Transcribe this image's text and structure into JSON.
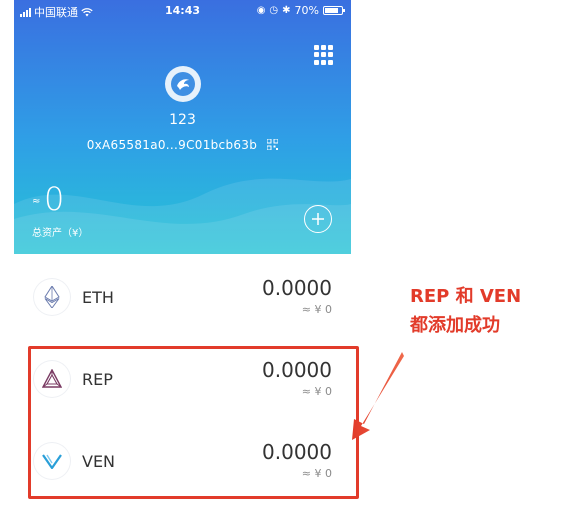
{
  "status_bar": {
    "carrier": "中国联通",
    "time": "14:43",
    "battery": "70%"
  },
  "wallet": {
    "name": "123",
    "address": "0xA65581a0...9C01bcb63b",
    "approx_symbol": "≈",
    "total_value": "0",
    "total_label": "总资产（¥）"
  },
  "tokens": [
    {
      "symbol": "ETH",
      "balance": "0.0000",
      "fiat": "≈ ¥ 0",
      "icon": "eth-icon"
    },
    {
      "symbol": "REP",
      "balance": "0.0000",
      "fiat": "≈ ¥ 0",
      "icon": "rep-icon"
    },
    {
      "symbol": "VEN",
      "balance": "0.0000",
      "fiat": "≈ ¥ 0",
      "icon": "ven-icon"
    }
  ],
  "annotation": {
    "line1": "REP 和 VEN",
    "line2": "都添加成功",
    "color": "#e23b2a"
  },
  "colors": {
    "header_top": "#3a6fe0",
    "header_bottom": "#27c4d6"
  }
}
